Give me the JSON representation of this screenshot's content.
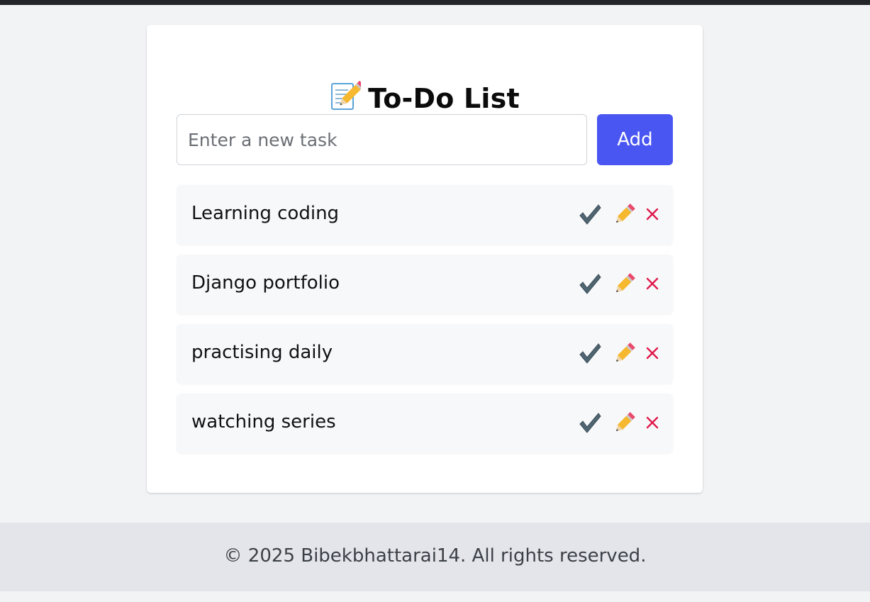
{
  "header": {
    "title": "To-Do List",
    "title_icon": "memo-pencil-icon"
  },
  "form": {
    "input_placeholder": "Enter a new task",
    "input_value": "",
    "add_label": "Add"
  },
  "tasks": [
    {
      "label": "Learning coding",
      "actions": [
        "check-icon",
        "pencil-icon",
        "close-icon"
      ]
    },
    {
      "label": "Django portfolio",
      "actions": [
        "check-icon",
        "pencil-icon",
        "close-icon"
      ]
    },
    {
      "label": "practising daily",
      "actions": [
        "check-icon",
        "pencil-icon",
        "close-icon"
      ]
    },
    {
      "label": "watching series",
      "actions": [
        "check-icon",
        "pencil-icon",
        "close-icon"
      ]
    }
  ],
  "footer": {
    "text": "© 2025 Bibekbhattarai14. All rights reserved."
  },
  "colors": {
    "accent": "#4a56f2",
    "page_bg": "#f2f3f5",
    "footer_bg": "#e4e5ea",
    "delete": "#e0194c",
    "check": "#4f6571"
  }
}
